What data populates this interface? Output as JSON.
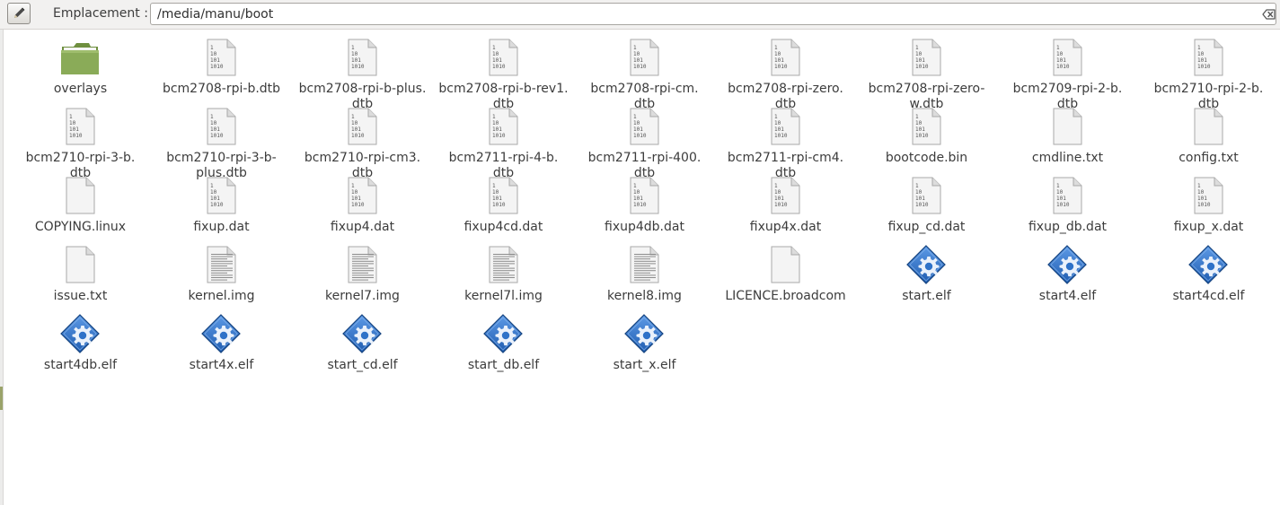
{
  "location_bar": {
    "label": "Emplacement :",
    "path": "/media/manu/boot",
    "edit_icon": "pencil-icon",
    "clear_icon": "clear-text-icon"
  },
  "colors": {
    "folder": "#8aab58",
    "elf_blue": "#2f72c8",
    "text": "#3c3c3c",
    "toolbar": "#f2f1f0"
  },
  "files": [
    {
      "name": "overlays",
      "icon": "folder-icon"
    },
    {
      "name": "bcm2708-rpi-b.dtb",
      "icon": "binary-file-icon"
    },
    {
      "name": "bcm2708-rpi-b-plus.\ndtb",
      "icon": "binary-file-icon"
    },
    {
      "name": "bcm2708-rpi-b-rev1.\ndtb",
      "icon": "binary-file-icon"
    },
    {
      "name": "bcm2708-rpi-cm.\ndtb",
      "icon": "binary-file-icon"
    },
    {
      "name": "bcm2708-rpi-zero.\ndtb",
      "icon": "binary-file-icon"
    },
    {
      "name": "bcm2708-rpi-zero-\nw.dtb",
      "icon": "binary-file-icon"
    },
    {
      "name": "bcm2709-rpi-2-b.\ndtb",
      "icon": "binary-file-icon"
    },
    {
      "name": "bcm2710-rpi-2-b.\ndtb",
      "icon": "binary-file-icon"
    },
    {
      "name": "bcm2710-rpi-3-b.\ndtb",
      "icon": "binary-file-icon"
    },
    {
      "name": "bcm2710-rpi-3-b-\nplus.dtb",
      "icon": "binary-file-icon"
    },
    {
      "name": "bcm2710-rpi-cm3.\ndtb",
      "icon": "binary-file-icon"
    },
    {
      "name": "bcm2711-rpi-4-b.\ndtb",
      "icon": "binary-file-icon"
    },
    {
      "name": "bcm2711-rpi-400.\ndtb",
      "icon": "binary-file-icon"
    },
    {
      "name": "bcm2711-rpi-cm4.\ndtb",
      "icon": "binary-file-icon"
    },
    {
      "name": "bootcode.bin",
      "icon": "binary-file-icon"
    },
    {
      "name": "cmdline.txt",
      "icon": "blank-file-icon"
    },
    {
      "name": "config.txt",
      "icon": "blank-file-icon"
    },
    {
      "name": "COPYING.linux",
      "icon": "blank-file-icon"
    },
    {
      "name": "fixup.dat",
      "icon": "binary-file-icon"
    },
    {
      "name": "fixup4.dat",
      "icon": "binary-file-icon"
    },
    {
      "name": "fixup4cd.dat",
      "icon": "binary-file-icon"
    },
    {
      "name": "fixup4db.dat",
      "icon": "binary-file-icon"
    },
    {
      "name": "fixup4x.dat",
      "icon": "binary-file-icon"
    },
    {
      "name": "fixup_cd.dat",
      "icon": "binary-file-icon"
    },
    {
      "name": "fixup_db.dat",
      "icon": "binary-file-icon"
    },
    {
      "name": "fixup_x.dat",
      "icon": "binary-file-icon"
    },
    {
      "name": "issue.txt",
      "icon": "blank-file-icon"
    },
    {
      "name": "kernel.img",
      "icon": "text-file-icon"
    },
    {
      "name": "kernel7.img",
      "icon": "text-file-icon"
    },
    {
      "name": "kernel7l.img",
      "icon": "text-file-icon"
    },
    {
      "name": "kernel8.img",
      "icon": "text-file-icon"
    },
    {
      "name": "LICENCE.broadcom",
      "icon": "blank-file-icon"
    },
    {
      "name": "start.elf",
      "icon": "executable-gear-icon"
    },
    {
      "name": "start4.elf",
      "icon": "executable-gear-icon"
    },
    {
      "name": "start4cd.elf",
      "icon": "executable-gear-icon"
    },
    {
      "name": "start4db.elf",
      "icon": "executable-gear-icon"
    },
    {
      "name": "start4x.elf",
      "icon": "executable-gear-icon"
    },
    {
      "name": "start_cd.elf",
      "icon": "executable-gear-icon"
    },
    {
      "name": "start_db.elf",
      "icon": "executable-gear-icon"
    },
    {
      "name": "start_x.elf",
      "icon": "executable-gear-icon"
    }
  ]
}
